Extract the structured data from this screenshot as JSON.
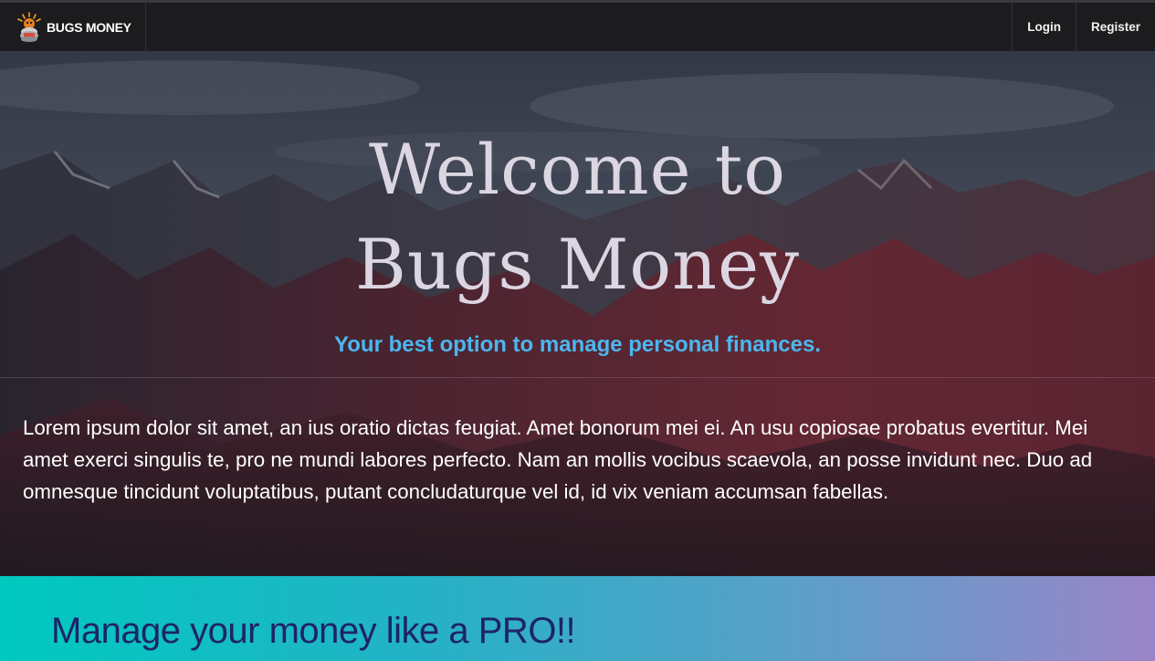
{
  "navbar": {
    "brand": "BUGS MONEY",
    "links": [
      "Login",
      "Register"
    ]
  },
  "hero": {
    "title_line1": "Welcome to",
    "title_line2": "Bugs Money",
    "subtitle": "Your best option to manage personal finances.",
    "body": "Lorem ipsum dolor sit amet, an ius oratio dictas feugiat. Amet bonorum mei ei. An usu copiosae probatus evertitur. Mei amet exerci singulis te, pro ne mundi labores perfecto. Nam an mollis vocibus scaevola, an posse invidunt nec. Duo ad omnesque tincidunt voluptatibus, putant concludaturque vel id, id vix veniam accumsan fabellas."
  },
  "promo": {
    "title": "Manage your money like a PRO!!"
  },
  "colors": {
    "navbar_bg": "#1c1c1e",
    "title_text": "#dcd6e2",
    "subtitle_accent": "#4cb6f0",
    "promo_gradient_start": "#00c9bf",
    "promo_gradient_end": "#9a84c8",
    "promo_text": "#1f2467"
  },
  "icons": {
    "brand_logo": "bug-money-logo-icon"
  }
}
